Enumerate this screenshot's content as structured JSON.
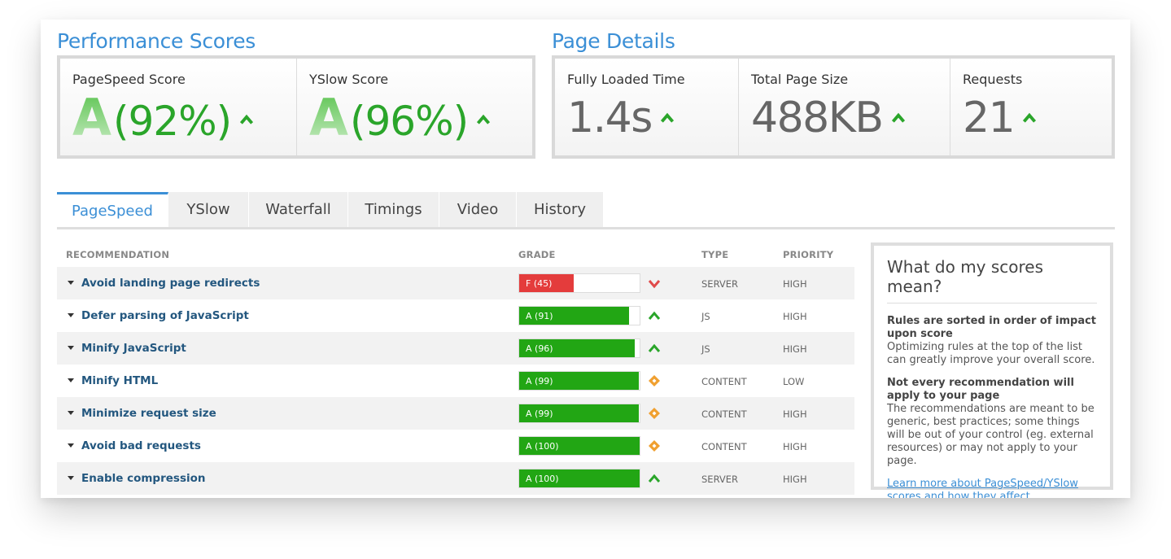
{
  "performance": {
    "title": "Performance Scores",
    "pagespeed": {
      "label": "PageSpeed Score",
      "grade": "A",
      "percent": "(92%)"
    },
    "yslow": {
      "label": "YSlow Score",
      "grade": "A",
      "percent": "(96%)"
    }
  },
  "page_details": {
    "title": "Page Details",
    "loaded": {
      "label": "Fully Loaded Time",
      "value": "1.4s"
    },
    "size": {
      "label": "Total Page Size",
      "value": "488KB"
    },
    "requests": {
      "label": "Requests",
      "value": "21"
    }
  },
  "tabs": [
    "PageSpeed",
    "YSlow",
    "Waterfall",
    "Timings",
    "Video",
    "History"
  ],
  "active_tab": "PageSpeed",
  "table": {
    "headers": {
      "recommendation": "RECOMMENDATION",
      "grade": "GRADE",
      "type": "TYPE",
      "priority": "PRIORITY"
    },
    "rows": [
      {
        "name": "Avoid landing page redirects",
        "grade": "F (45)",
        "score": 45,
        "status": "bad",
        "trend": "down",
        "type": "SERVER",
        "priority": "HIGH"
      },
      {
        "name": "Defer parsing of JavaScript",
        "grade": "A (91)",
        "score": 91,
        "status": "good",
        "trend": "up",
        "type": "JS",
        "priority": "HIGH"
      },
      {
        "name": "Minify JavaScript",
        "grade": "A (96)",
        "score": 96,
        "status": "good",
        "trend": "up",
        "type": "JS",
        "priority": "HIGH"
      },
      {
        "name": "Minify HTML",
        "grade": "A (99)",
        "score": 99,
        "status": "good",
        "trend": "neutral",
        "type": "CONTENT",
        "priority": "LOW"
      },
      {
        "name": "Minimize request size",
        "grade": "A (99)",
        "score": 99,
        "status": "good",
        "trend": "neutral",
        "type": "CONTENT",
        "priority": "HIGH"
      },
      {
        "name": "Avoid bad requests",
        "grade": "A (100)",
        "score": 100,
        "status": "good",
        "trend": "neutral",
        "type": "CONTENT",
        "priority": "HIGH"
      },
      {
        "name": "Enable compression",
        "grade": "A (100)",
        "score": 100,
        "status": "good",
        "trend": "up",
        "type": "SERVER",
        "priority": "HIGH"
      }
    ]
  },
  "info": {
    "title": "What do my scores mean?",
    "p1_strong": "Rules are sorted in order of impact upon score",
    "p1_text": "Optimizing rules at the top of the list can greatly improve your overall score.",
    "p2_strong": "Not every recommendation will apply to your page",
    "p2_text": "The recommendations are meant to be generic, best practices; some things will be out of your control (eg. external resources) or may not apply to your page.",
    "link": "Learn more about PageSpeed/YSlow scores and how they affect performance."
  },
  "colors": {
    "accent": "#3b8fd6",
    "good": "#22a614",
    "bad": "#e43c3c",
    "warn": "#f0a030",
    "up": "#2aa52a",
    "down": "#e04a4a"
  }
}
